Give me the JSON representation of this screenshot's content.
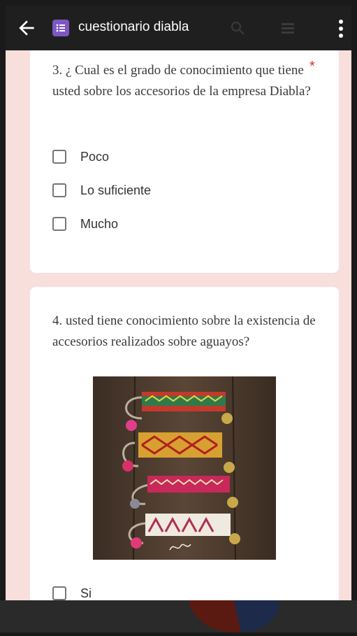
{
  "appbar": {
    "title": "cuestionario diabla",
    "back_icon": "arrow-back-icon",
    "forms_icon": "forms-list-icon",
    "more_icon": "more-vert-icon"
  },
  "question3": {
    "text": "3. ¿ Cual es el grado de conocimiento que tiene usted sobre los accesorios de la empresa Diabla?",
    "required_mark": "*",
    "options": [
      "Poco",
      "Lo suficiente",
      "Mucho"
    ]
  },
  "question4": {
    "text": "4. usted tiene conocimiento sobre la existencia de accesorios realizados sobre aguayos?",
    "options": [
      "Si"
    ],
    "image": "woven-bracelets-photo"
  },
  "colors": {
    "accent": "#673ab7",
    "background": "#f8dfdc",
    "required": "#d93025"
  }
}
